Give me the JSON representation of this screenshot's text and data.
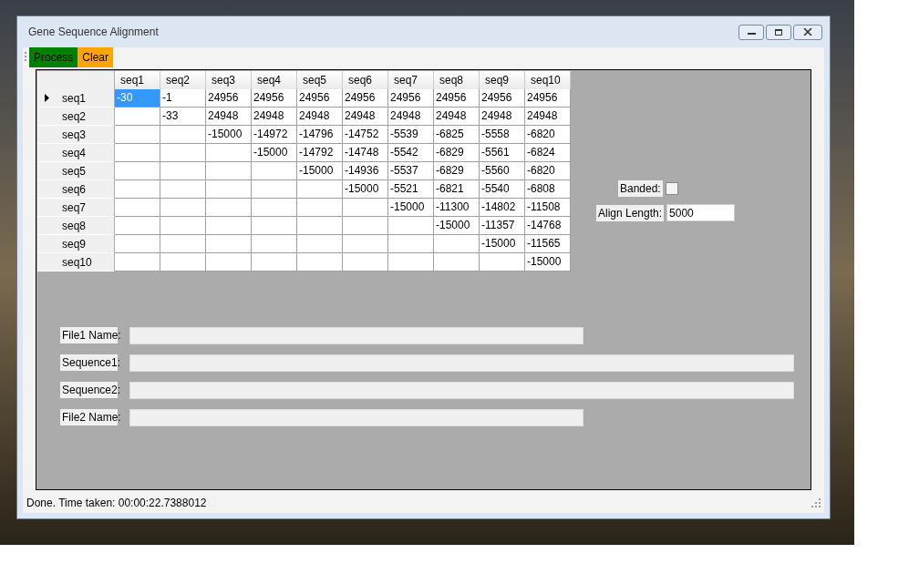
{
  "window": {
    "title": "Gene Sequence Alignment"
  },
  "toolbar": [
    {
      "label": "Process",
      "color": "#008000"
    },
    {
      "label": "Clear",
      "color": "#ffa500"
    }
  ],
  "grid": {
    "columns": [
      "seq1",
      "seq2",
      "seq3",
      "seq4",
      "seq5",
      "seq6",
      "seq7",
      "seq8",
      "seq9",
      "seq10"
    ],
    "rows": [
      {
        "header": "seq1",
        "current": true,
        "cells": [
          {
            "value": "-30",
            "selected": true
          },
          {
            "value": "-1",
            "selected": false
          },
          {
            "value": "24956",
            "selected": false
          },
          {
            "value": "24956",
            "selected": false
          },
          {
            "value": "24956",
            "selected": false
          },
          {
            "value": "24956",
            "selected": false
          },
          {
            "value": "24956",
            "selected": false
          },
          {
            "value": "24956",
            "selected": false
          },
          {
            "value": "24956",
            "selected": false
          },
          {
            "value": "24956",
            "selected": false
          }
        ]
      },
      {
        "header": "seq2",
        "current": false,
        "cells": [
          null,
          {
            "value": "-33",
            "selected": false
          },
          {
            "value": "24948",
            "selected": false
          },
          {
            "value": "24948",
            "selected": false
          },
          {
            "value": "24948",
            "selected": false
          },
          {
            "value": "24948",
            "selected": false
          },
          {
            "value": "24948",
            "selected": false
          },
          {
            "value": "24948",
            "selected": false
          },
          {
            "value": "24948",
            "selected": false
          },
          {
            "value": "24948",
            "selected": false
          }
        ]
      },
      {
        "header": "seq3",
        "current": false,
        "cells": [
          null,
          null,
          {
            "value": "-15000",
            "selected": false
          },
          {
            "value": "-14972",
            "selected": false
          },
          {
            "value": "-14796",
            "selected": false
          },
          {
            "value": "-14752",
            "selected": false
          },
          {
            "value": "-5539",
            "selected": false
          },
          {
            "value": "-6825",
            "selected": false
          },
          {
            "value": "-5558",
            "selected": false
          },
          {
            "value": "-6820",
            "selected": false
          }
        ]
      },
      {
        "header": "seq4",
        "current": false,
        "cells": [
          null,
          null,
          null,
          {
            "value": "-15000",
            "selected": false
          },
          {
            "value": "-14792",
            "selected": false
          },
          {
            "value": "-14748",
            "selected": false
          },
          {
            "value": "-5542",
            "selected": false
          },
          {
            "value": "-6829",
            "selected": false
          },
          {
            "value": "-5561",
            "selected": false
          },
          {
            "value": "-6824",
            "selected": false
          }
        ]
      },
      {
        "header": "seq5",
        "current": false,
        "cells": [
          null,
          null,
          null,
          null,
          {
            "value": "-15000",
            "selected": false
          },
          {
            "value": "-14936",
            "selected": false
          },
          {
            "value": "-5537",
            "selected": false
          },
          {
            "value": "-6829",
            "selected": false
          },
          {
            "value": "-5560",
            "selected": false
          },
          {
            "value": "-6820",
            "selected": false
          }
        ]
      },
      {
        "header": "seq6",
        "current": false,
        "cells": [
          null,
          null,
          null,
          null,
          null,
          {
            "value": "-15000",
            "selected": false
          },
          {
            "value": "-5521",
            "selected": false
          },
          {
            "value": "-6821",
            "selected": false
          },
          {
            "value": "-5540",
            "selected": false
          },
          {
            "value": "-6808",
            "selected": false
          }
        ]
      },
      {
        "header": "seq7",
        "current": false,
        "cells": [
          null,
          null,
          null,
          null,
          null,
          null,
          {
            "value": "-15000",
            "selected": false
          },
          {
            "value": "-11300",
            "selected": false
          },
          {
            "value": "-14802",
            "selected": false
          },
          {
            "value": "-11508",
            "selected": false
          }
        ]
      },
      {
        "header": "seq8",
        "current": false,
        "cells": [
          null,
          null,
          null,
          null,
          null,
          null,
          null,
          {
            "value": "-15000",
            "selected": false
          },
          {
            "value": "-11357",
            "selected": false
          },
          {
            "value": "-14768",
            "selected": false
          }
        ]
      },
      {
        "header": "seq9",
        "current": false,
        "cells": [
          null,
          null,
          null,
          null,
          null,
          null,
          null,
          null,
          {
            "value": "-15000",
            "selected": false
          },
          {
            "value": "-11565",
            "selected": false
          }
        ]
      },
      {
        "header": "seq10",
        "current": false,
        "cells": [
          null,
          null,
          null,
          null,
          null,
          null,
          null,
          null,
          null,
          {
            "value": "-15000",
            "selected": false
          }
        ]
      }
    ]
  },
  "banded": {
    "label": "Banded:",
    "checked": false
  },
  "align_length": {
    "label": "Align Length:",
    "value": "5000"
  },
  "fields": [
    {
      "label": "File1 Name:",
      "kind": "short"
    },
    {
      "label": "Sequence1:",
      "kind": "long"
    },
    {
      "label": "Sequence2:",
      "kind": "long"
    },
    {
      "label": "File2 Name:",
      "kind": "short"
    }
  ],
  "status_bar": "Done.  Time taken: 00:00:22.7388012"
}
